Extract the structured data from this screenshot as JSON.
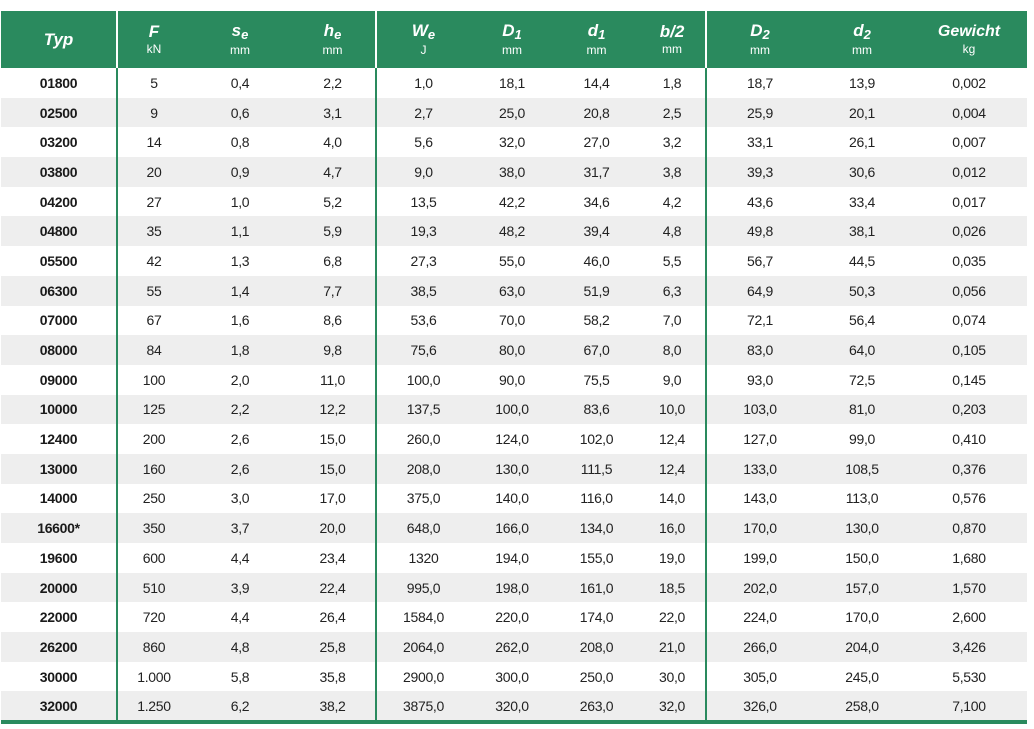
{
  "header": {
    "typ": "Typ",
    "cols": [
      {
        "sym": "F",
        "sub": "",
        "unit": "kN"
      },
      {
        "sym": "s",
        "sub": "e",
        "unit": "mm"
      },
      {
        "sym": "h",
        "sub": "e",
        "unit": "mm"
      },
      {
        "sym": "W",
        "sub": "e",
        "unit": "J"
      },
      {
        "sym": "D",
        "sub": "1",
        "unit": "mm"
      },
      {
        "sym": "d",
        "sub": "1",
        "unit": "mm"
      },
      {
        "sym": "b/2",
        "sub": "",
        "unit": "mm"
      },
      {
        "sym": "D",
        "sub": "2",
        "unit": "mm"
      },
      {
        "sym": "d",
        "sub": "2",
        "unit": "mm"
      },
      {
        "sym": "Gewicht",
        "sub": "",
        "unit": "kg"
      }
    ]
  },
  "rows": [
    [
      "01800",
      "5",
      "0,4",
      "2,2",
      "1,0",
      "18,1",
      "14,4",
      "1,8",
      "18,7",
      "13,9",
      "0,002"
    ],
    [
      "02500",
      "9",
      "0,6",
      "3,1",
      "2,7",
      "25,0",
      "20,8",
      "2,5",
      "25,9",
      "20,1",
      "0,004"
    ],
    [
      "03200",
      "14",
      "0,8",
      "4,0",
      "5,6",
      "32,0",
      "27,0",
      "3,2",
      "33,1",
      "26,1",
      "0,007"
    ],
    [
      "03800",
      "20",
      "0,9",
      "4,7",
      "9,0",
      "38,0",
      "31,7",
      "3,8",
      "39,3",
      "30,6",
      "0,012"
    ],
    [
      "04200",
      "27",
      "1,0",
      "5,2",
      "13,5",
      "42,2",
      "34,6",
      "4,2",
      "43,6",
      "33,4",
      "0,017"
    ],
    [
      "04800",
      "35",
      "1,1",
      "5,9",
      "19,3",
      "48,2",
      "39,4",
      "4,8",
      "49,8",
      "38,1",
      "0,026"
    ],
    [
      "05500",
      "42",
      "1,3",
      "6,8",
      "27,3",
      "55,0",
      "46,0",
      "5,5",
      "56,7",
      "44,5",
      "0,035"
    ],
    [
      "06300",
      "55",
      "1,4",
      "7,7",
      "38,5",
      "63,0",
      "51,9",
      "6,3",
      "64,9",
      "50,3",
      "0,056"
    ],
    [
      "07000",
      "67",
      "1,6",
      "8,6",
      "53,6",
      "70,0",
      "58,2",
      "7,0",
      "72,1",
      "56,4",
      "0,074"
    ],
    [
      "08000",
      "84",
      "1,8",
      "9,8",
      "75,6",
      "80,0",
      "67,0",
      "8,0",
      "83,0",
      "64,0",
      "0,105"
    ],
    [
      "09000",
      "100",
      "2,0",
      "11,0",
      "100,0",
      "90,0",
      "75,5",
      "9,0",
      "93,0",
      "72,5",
      "0,145"
    ],
    [
      "10000",
      "125",
      "2,2",
      "12,2",
      "137,5",
      "100,0",
      "83,6",
      "10,0",
      "103,0",
      "81,0",
      "0,203"
    ],
    [
      "12400",
      "200",
      "2,6",
      "15,0",
      "260,0",
      "124,0",
      "102,0",
      "12,4",
      "127,0",
      "99,0",
      "0,410"
    ],
    [
      "13000",
      "160",
      "2,6",
      "15,0",
      "208,0",
      "130,0",
      "111,5",
      "12,4",
      "133,0",
      "108,5",
      "0,376"
    ],
    [
      "14000",
      "250",
      "3,0",
      "17,0",
      "375,0",
      "140,0",
      "116,0",
      "14,0",
      "143,0",
      "113,0",
      "0,576"
    ],
    [
      "16600*",
      "350",
      "3,7",
      "20,0",
      "648,0",
      "166,0",
      "134,0",
      "16,0",
      "170,0",
      "130,0",
      "0,870"
    ],
    [
      "19600",
      "600",
      "4,4",
      "23,4",
      "1320",
      "194,0",
      "155,0",
      "19,0",
      "199,0",
      "150,0",
      "1,680"
    ],
    [
      "20000",
      "510",
      "3,9",
      "22,4",
      "995,0",
      "198,0",
      "161,0",
      "18,5",
      "202,0",
      "157,0",
      "1,570"
    ],
    [
      "22000",
      "720",
      "4,4",
      "26,4",
      "1584,0",
      "220,0",
      "174,0",
      "22,0",
      "224,0",
      "170,0",
      "2,600"
    ],
    [
      "26200",
      "860",
      "4,8",
      "25,8",
      "2064,0",
      "262,0",
      "208,0",
      "21,0",
      "266,0",
      "204,0",
      "3,426"
    ],
    [
      "30000",
      "1.000",
      "5,8",
      "35,8",
      "2900,0",
      "300,0",
      "250,0",
      "30,0",
      "305,0",
      "245,0",
      "5,530"
    ],
    [
      "32000",
      "1.250",
      "6,2",
      "38,2",
      "3875,0",
      "320,0",
      "263,0",
      "32,0",
      "326,0",
      "258,0",
      "7,100"
    ]
  ],
  "colors": {
    "header_bg": "#2a8a5e",
    "stripe": "#eeeeee"
  }
}
